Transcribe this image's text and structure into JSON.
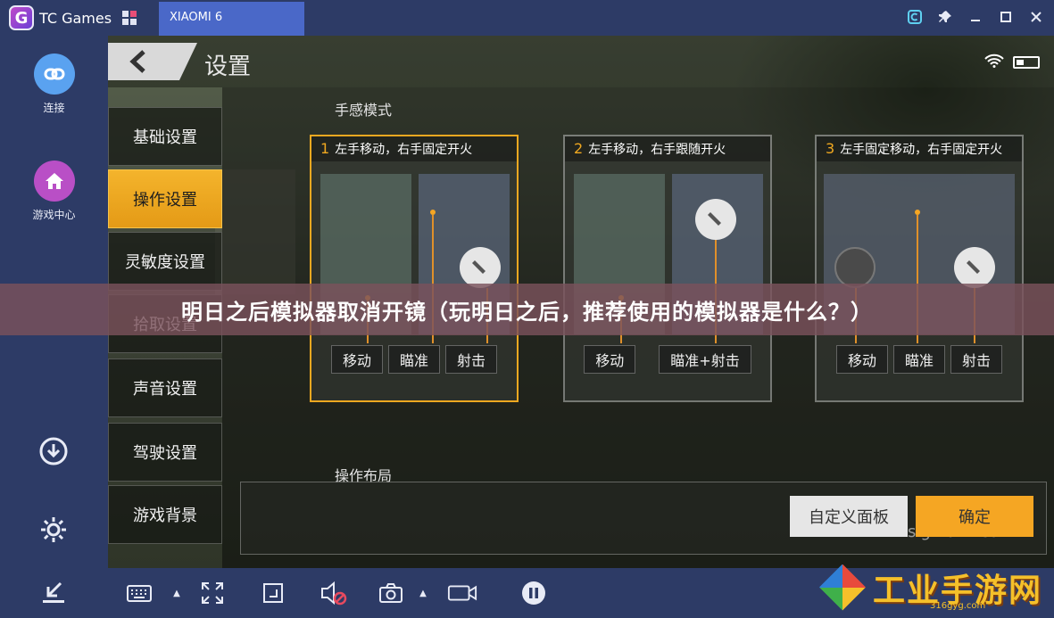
{
  "window": {
    "brand_name": "TC Games",
    "tab_label": "XIAOMI 6"
  },
  "sidebar": {
    "connect_label": "连接",
    "game_center_label": "游戏中心"
  },
  "game": {
    "header_title": "设置",
    "menu": [
      {
        "label": "基础设置"
      },
      {
        "label": "操作设置",
        "active": true
      },
      {
        "label": "灵敏度设置"
      },
      {
        "label": "拾取设置"
      },
      {
        "label": "声音设置"
      },
      {
        "label": "驾驶设置"
      },
      {
        "label": "游戏背景"
      }
    ],
    "section_touch_mode": "手感模式",
    "modes": [
      {
        "num": "1",
        "title": "左手移动，右手固定开火",
        "buttons": [
          "移动",
          "瞄准",
          "射击"
        ],
        "selected": true
      },
      {
        "num": "2",
        "title": "左手移动，右手跟随开火",
        "buttons": [
          "移动",
          "瞄准+射击"
        ],
        "selected": false
      },
      {
        "num": "3",
        "title": "左手固定移动，右手固定开火",
        "buttons": [
          "移动",
          "瞄准",
          "射击"
        ],
        "selected": false
      }
    ],
    "section_layout": "操作布局",
    "custom_panel_button": "自定义面板",
    "confirm_button": "确定",
    "watermark_url": "sigma-rt.com"
  },
  "banner_text": "明日之后模拟器取消开镜（玩明日之后，推荐使用的模拟器是什么？）",
  "corner_watermark": {
    "text": "工业手游网",
    "sub": "316gyg.com"
  },
  "colors": {
    "chrome": "#2d3b66",
    "tab_active": "#4a68c8",
    "accent_orange": "#f5a623",
    "banner": "#7a525c"
  }
}
